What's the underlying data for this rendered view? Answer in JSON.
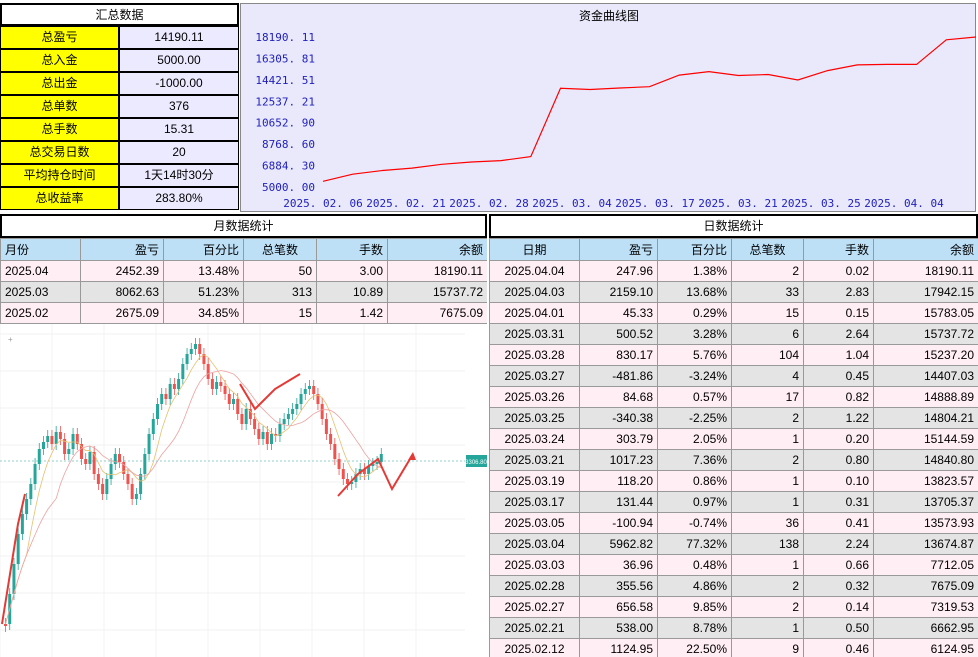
{
  "summary": {
    "title": "汇总数据",
    "rows": [
      {
        "label": "总盈亏",
        "value": "14190.11"
      },
      {
        "label": "总入金",
        "value": "5000.00"
      },
      {
        "label": "总出金",
        "value": "-1000.00"
      },
      {
        "label": "总单数",
        "value": "376"
      },
      {
        "label": "总手数",
        "value": "15.31"
      },
      {
        "label": "总交易日数",
        "value": "20"
      },
      {
        "label": "平均持仓时间",
        "value": "1天14时30分"
      },
      {
        "label": "总收益率",
        "value": "283.80%"
      }
    ]
  },
  "chart_data": {
    "type": "line",
    "title": "资金曲线图",
    "y_tick_labels": [
      "18190. 11",
      "16305. 81",
      "14421. 51",
      "12537. 21",
      "10652. 90",
      "8768. 60",
      "6884. 30",
      "5000. 00"
    ],
    "y_ticks": [
      18190.11,
      16305.81,
      14421.51,
      12537.21,
      10652.9,
      8768.6,
      6884.3,
      5000.0
    ],
    "ylim": [
      5000.0,
      18190.11
    ],
    "x_tick_labels": [
      "2025. 02. 06",
      "2025. 02. 21",
      "2025. 02. 28",
      "2025. 03. 04",
      "2025. 03. 17",
      "2025. 03. 21",
      "2025. 03. 25",
      "2025. 04. 04"
    ],
    "x": [
      "2025.02.06",
      "2025.02.12",
      "2025.02.17",
      "2025.02.19",
      "2025.02.21",
      "2025.02.26",
      "2025.02.27",
      "2025.02.28",
      "2025.03.03",
      "2025.03.04",
      "2025.03.05",
      "2025.03.17",
      "2025.03.19",
      "2025.03.21",
      "2025.03.24",
      "2025.03.25",
      "2025.03.26",
      "2025.03.27",
      "2025.03.28",
      "2025.03.31",
      "2025.04.01",
      "2025.04.03",
      "2025.04.04"
    ],
    "values": [
      5500,
      6124.95,
      6450,
      6662.95,
      7000,
      7200,
      7319.53,
      7675.09,
      13674.87,
      13573.93,
      13705.37,
      13823.57,
      14840.8,
      15144.59,
      14804.21,
      14888.89,
      14407.03,
      15237.2,
      15737.72,
      15783.05,
      15783.05,
      17942.15,
      18190.11
    ],
    "line_color": "#ff0000",
    "background": "#e9e9fb",
    "grid": false
  },
  "monthly": {
    "title": "月数据统计",
    "headers": [
      "月份",
      "盈亏",
      "百分比",
      "总笔数",
      "手数",
      "余额"
    ],
    "rows": [
      [
        "2025.04",
        "2452.39",
        "13.48%",
        "50",
        "3.00",
        "18190.11"
      ],
      [
        "2025.03",
        "8062.63",
        "51.23%",
        "313",
        "10.89",
        "15737.72"
      ],
      [
        "2025.02",
        "2675.09",
        "34.85%",
        "15",
        "1.42",
        "7675.09"
      ]
    ]
  },
  "daily": {
    "title": "日数据统计",
    "headers": [
      "日期",
      "盈亏",
      "百分比",
      "总笔数",
      "手数",
      "余额"
    ],
    "rows": [
      [
        "2025.04.04",
        "247.96",
        "1.38%",
        "2",
        "0.02",
        "18190.11"
      ],
      [
        "2025.04.03",
        "2159.10",
        "13.68%",
        "33",
        "2.83",
        "17942.15"
      ],
      [
        "2025.04.01",
        "45.33",
        "0.29%",
        "15",
        "0.15",
        "15783.05"
      ],
      [
        "2025.03.31",
        "500.52",
        "3.28%",
        "6",
        "2.64",
        "15737.72"
      ],
      [
        "2025.03.28",
        "830.17",
        "5.76%",
        "104",
        "1.04",
        "15237.20"
      ],
      [
        "2025.03.27",
        "-481.86",
        "-3.24%",
        "4",
        "0.45",
        "14407.03"
      ],
      [
        "2025.03.26",
        "84.68",
        "0.57%",
        "17",
        "0.82",
        "14888.89"
      ],
      [
        "2025.03.25",
        "-340.38",
        "-2.25%",
        "2",
        "1.22",
        "14804.21"
      ],
      [
        "2025.03.24",
        "303.79",
        "2.05%",
        "1",
        "0.20",
        "15144.59"
      ],
      [
        "2025.03.21",
        "1017.23",
        "7.36%",
        "2",
        "0.80",
        "14840.80"
      ],
      [
        "2025.03.19",
        "118.20",
        "0.86%",
        "1",
        "0.10",
        "13823.57"
      ],
      [
        "2025.03.17",
        "131.44",
        "0.97%",
        "1",
        "0.31",
        "13705.37"
      ],
      [
        "2025.03.05",
        "-100.94",
        "-0.74%",
        "36",
        "0.41",
        "13573.93"
      ],
      [
        "2025.03.04",
        "5962.82",
        "77.32%",
        "138",
        "2.24",
        "13674.87"
      ],
      [
        "2025.03.03",
        "36.96",
        "0.48%",
        "1",
        "0.66",
        "7712.05"
      ],
      [
        "2025.02.28",
        "355.56",
        "4.86%",
        "2",
        "0.32",
        "7675.09"
      ],
      [
        "2025.02.27",
        "656.58",
        "9.85%",
        "2",
        "0.14",
        "7319.53"
      ],
      [
        "2025.02.21",
        "538.00",
        "8.78%",
        "1",
        "0.50",
        "6662.95"
      ],
      [
        "2025.02.12",
        "1124.95",
        "22.50%",
        "9",
        "0.46",
        "6124.95"
      ]
    ]
  },
  "candle_chart": {
    "price_tag": "3306.80",
    "up_color": "#26a69a",
    "down_color": "#ef5350"
  }
}
